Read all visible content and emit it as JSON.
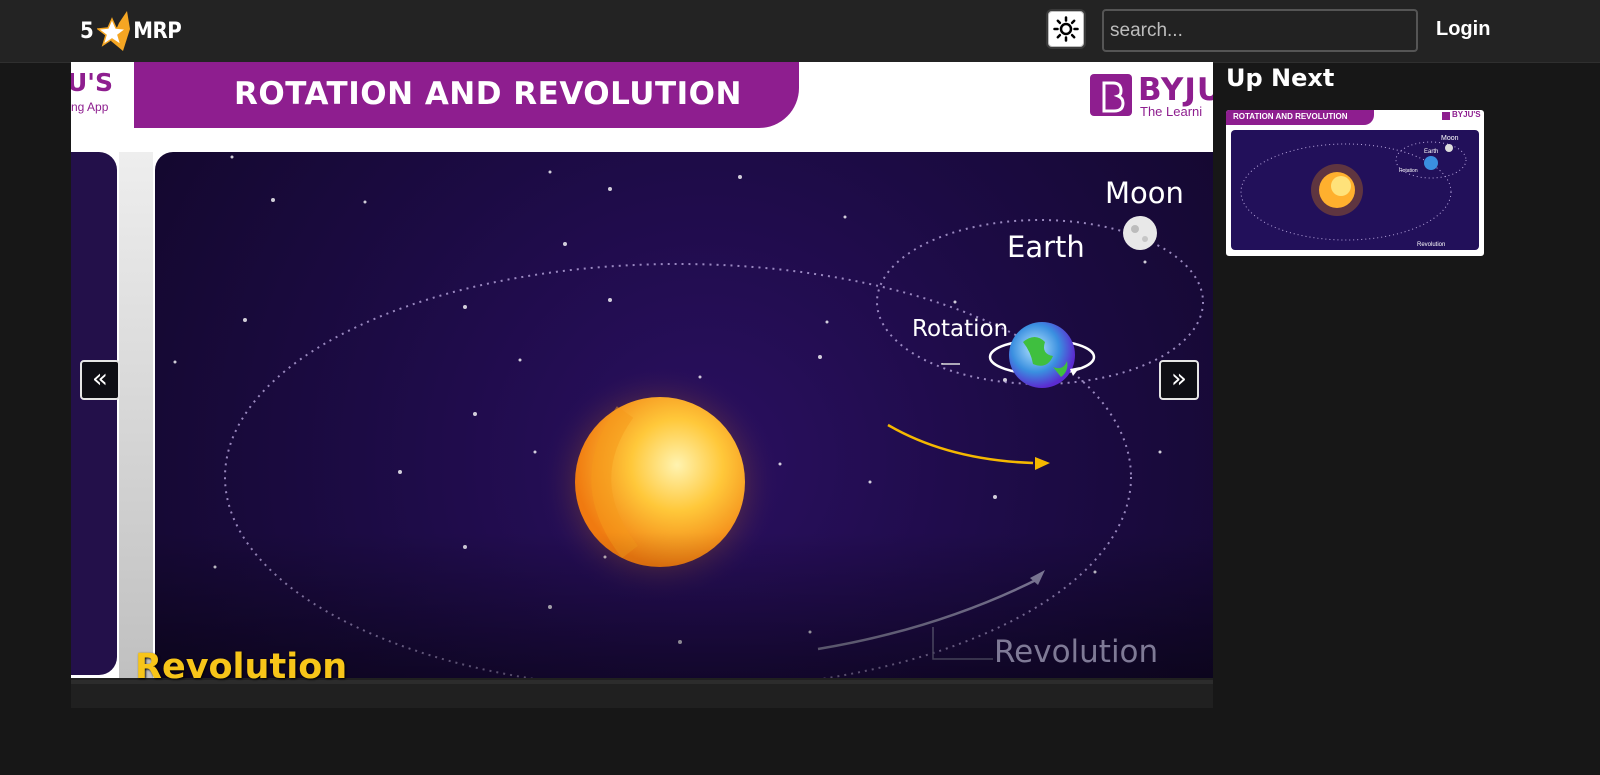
{
  "header": {
    "logo_number": "5",
    "logo_text": "MRP",
    "search_placeholder": "search...",
    "login_label": "Login",
    "theme_toggle_icon": "sun-icon"
  },
  "player": {
    "slide_title": "ROTATION AND REVOLUTION",
    "brand_name": "BYJU'S",
    "brand_left_text": "U'S",
    "brand_left_subtext": "ng App",
    "brand_right_text": "BYJU",
    "brand_right_tagline": "The Learni",
    "labels": {
      "moon": "Moon",
      "earth": "Earth",
      "rotation": "Rotation",
      "revolution_diagram": "Revolution"
    },
    "caption": "Revolution",
    "prev_label": "«",
    "next_label": "»"
  },
  "sidebar": {
    "heading": "Up Next",
    "items": [
      {
        "thumb_title": "ROTATION AND REVOLUTION",
        "thumb_brand": "BYJU'S",
        "thumb_moon": "Moon",
        "thumb_earth": "Earth",
        "thumb_rotation": "Rotation",
        "thumb_revolution": "Revolution"
      }
    ]
  },
  "colors": {
    "brand_purple": "#8e1e8f",
    "space_bg": "#1c0b44",
    "caption_yellow": "#f7c519",
    "page_bg": "#171717",
    "topbar_bg": "#232323"
  }
}
